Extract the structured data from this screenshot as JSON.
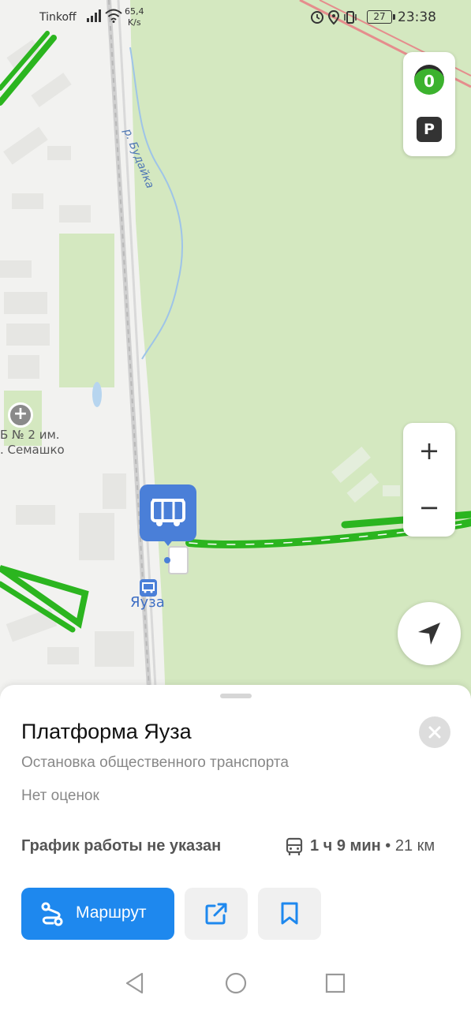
{
  "status_bar": {
    "carrier": "Tinkoff",
    "net_speed_value": "65,4",
    "net_speed_unit": "K/s",
    "battery": "27",
    "time": "23:38"
  },
  "map": {
    "traffic_level": "0",
    "parking_label": "P",
    "zoom_in_label": "+",
    "zoom_out_label": "−",
    "river_label": "р. Будайка",
    "stop_label": "Яуза",
    "hospital_label_line1": "Б № 2 им.",
    "hospital_label_line2": ". Семашко",
    "colors": {
      "park": "#d4e8c0",
      "traffic_green": "#2bb51f",
      "stop_blue": "#4a7fd8"
    }
  },
  "place": {
    "title": "Платформа Яуза",
    "type": "Остановка общественного транспорта",
    "rating": "Нет оценок",
    "hours": "График работы не указан",
    "transit_time": "1 ч 9 мин",
    "transit_distance": "• 21 км"
  },
  "actions": {
    "route_label": "Маршрут",
    "share_icon": "share-icon",
    "bookmark_icon": "bookmark-icon",
    "accent_color": "#1e88ee"
  },
  "nav": {
    "back_icon": "back-icon",
    "home_icon": "home-icon",
    "recent_icon": "recent-apps-icon"
  }
}
